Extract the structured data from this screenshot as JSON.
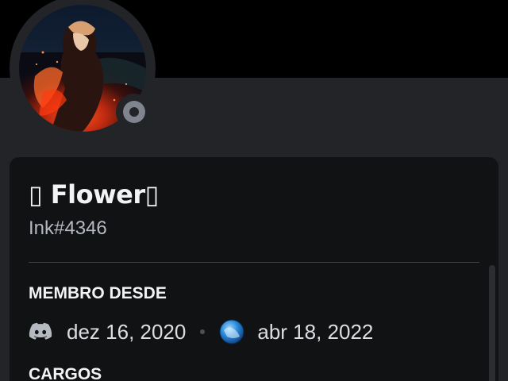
{
  "profile": {
    "display_name": "▯ Flower▯",
    "tag": "Ink#4346",
    "status": "offline",
    "status_color": "#80848e"
  },
  "sections": {
    "member_since_title": "MEMBRO DESDE",
    "discord_joined": "dez 16, 2020",
    "server_joined": "abr 18, 2022",
    "roles_title": "CARGOS"
  },
  "icons": {
    "discord": "discord-logo-icon",
    "server": "server-icon"
  },
  "colors": {
    "background": "#232428",
    "card": "#111214",
    "banner": "#000000",
    "text_primary": "#f2f3f5",
    "text_muted": "#b5bac1",
    "divider": "#3f4147"
  }
}
